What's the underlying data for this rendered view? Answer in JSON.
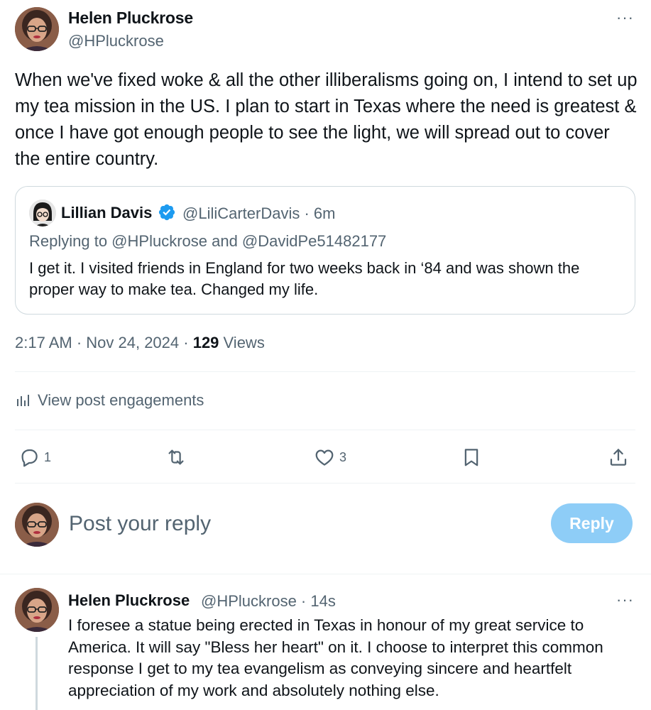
{
  "post": {
    "author_name": "Helen Pluckrose",
    "author_handle": "@HPluckrose",
    "more_label": "···",
    "text": "When we've fixed woke & all the other illiberalisms going on, I intend to set up my tea mission in the US. I plan to start in Texas where the need is greatest & once I have got enough people to see the light, we will spread out to cover the entire country.",
    "timestamp": "2:17 AM · Nov 24, 2024 · ",
    "views_count": "129",
    "views_label": " Views"
  },
  "quote": {
    "author_name": "Lillian Davis",
    "author_handle": "@LiliCarterDavis · 6m",
    "replying_to": "Replying to @HPluckrose and @DavidPe51482177",
    "text": "I get it. I visited friends in England for two weeks back in ‘84 and was shown the proper way to make tea. Changed my life."
  },
  "engagements_label": "View post engagements",
  "actions": {
    "reply_count": "1",
    "like_count": "3"
  },
  "composer": {
    "placeholder": "Post your reply",
    "reply_button": "Reply"
  },
  "reply": {
    "author_name": "Helen Pluckrose",
    "author_handle": "@HPluckrose · 14s",
    "more_label": "···",
    "text": "I foresee a statue being erected in Texas in honour of my great service to America. It will say \"Bless her heart\" on it. I choose to interpret this common response I get to my tea evangelism as conveying sincere and heartfelt appreciation of my work and absolutely nothing else."
  },
  "colors": {
    "accent": "#1d9bf0",
    "reply_button_disabled": "#8ecdf7",
    "secondary_text": "#536471",
    "border": "#cfd9de"
  },
  "icons": [
    "more-icon",
    "verified-icon",
    "analytics-icon",
    "reply-icon",
    "repost-icon",
    "like-icon",
    "bookmark-icon",
    "share-icon"
  ]
}
